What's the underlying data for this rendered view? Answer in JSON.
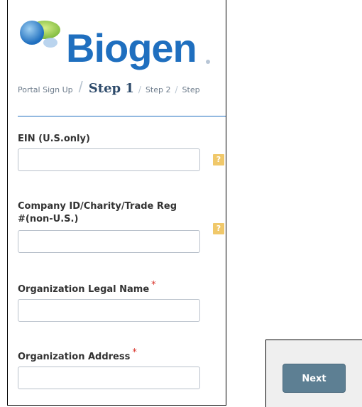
{
  "brand": {
    "name": "Biogen"
  },
  "breadcrumb": {
    "root": "Portal Sign Up",
    "current": "Step 1",
    "step2": "Step 2",
    "step3": "Step"
  },
  "form": {
    "ein": {
      "label": "EIN (U.S.only)",
      "value": "",
      "help": "?"
    },
    "company_id": {
      "label_line1": "Company ID/Charity/Trade Reg",
      "label_line2": "#(non-U.S.)",
      "value": "",
      "help": "?"
    },
    "legal_name": {
      "label": "Organization Legal Name",
      "required": "*",
      "value": ""
    },
    "address": {
      "label": "Organization Address",
      "required": "*",
      "value": ""
    }
  },
  "actions": {
    "next_label": "Next"
  },
  "colors": {
    "brand_blue": "#1f6fbf",
    "help_icon": "#f0c86a",
    "next_button": "#5d7f93",
    "required": "#d9342b"
  }
}
